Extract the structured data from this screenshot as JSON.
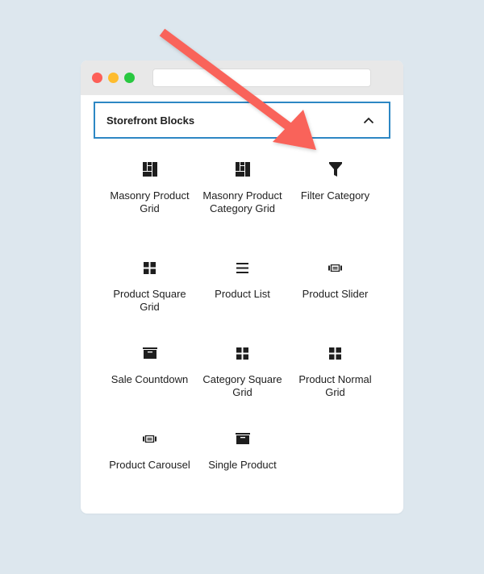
{
  "window": {
    "title_bar": {
      "buttons": [
        "close",
        "minimize",
        "maximize"
      ],
      "colors": {
        "close": "#fd5f57",
        "minimize": "#febc2e",
        "maximize": "#29c840"
      },
      "url": ""
    }
  },
  "panel": {
    "title": "Storefront Blocks",
    "expanded": true,
    "toggle_icon": "chevron-up-icon",
    "accent": "#2d87c4"
  },
  "blocks": [
    {
      "label": "Masonry Product Grid",
      "icon": "masonry-grid-icon"
    },
    {
      "label": "Masonry Product Category Grid",
      "icon": "masonry-grid-icon"
    },
    {
      "label": "Filter Category",
      "icon": "filter-icon"
    },
    {
      "label": "Product Square Grid",
      "icon": "square-grid-icon"
    },
    {
      "label": "Product List",
      "icon": "list-icon"
    },
    {
      "label": "Product Slider",
      "icon": "slider-icon"
    },
    {
      "label": "Sale Countdown",
      "icon": "archive-box-icon"
    },
    {
      "label": "Category Square Grid",
      "icon": "square-grid-icon"
    },
    {
      "label": "Product Normal Grid",
      "icon": "square-grid-icon"
    },
    {
      "label": "Product Carousel",
      "icon": "slider-icon"
    },
    {
      "label": "Single Product",
      "icon": "archive-box-icon"
    }
  ],
  "annotation": {
    "type": "arrow",
    "color": "#f9635a",
    "points_to": "Filter Category"
  }
}
